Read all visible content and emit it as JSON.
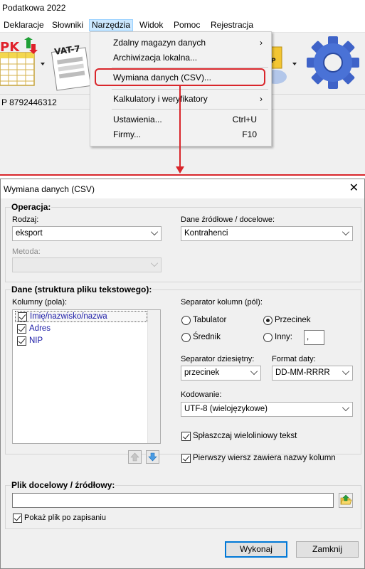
{
  "app": {
    "title": "Podatkowa 2022",
    "menu": [
      "Deklaracje",
      "Słowniki",
      "Narzędzia",
      "Widok",
      "Pomoc",
      "Rejestracja"
    ],
    "status_text": "P 8792446312",
    "toolbar_labels": {
      "vat7": "VAT-7",
      "pk_fragment": "PK"
    }
  },
  "narzedzia_menu": {
    "items": [
      {
        "label": "Zdalny magazyn danych",
        "shortcut": "",
        "submenu": true
      },
      {
        "label": "Archiwizacja lokalna...",
        "shortcut": "",
        "submenu": false
      },
      {
        "label": "Wymiana danych (CSV)...",
        "shortcut": "",
        "submenu": false
      },
      {
        "label": "Kalkulatory i weryfikatory",
        "shortcut": "",
        "submenu": true
      },
      {
        "label": "Ustawienia...",
        "shortcut": "Ctrl+U",
        "submenu": false
      },
      {
        "label": "Firmy...",
        "shortcut": "F10",
        "submenu": false
      }
    ],
    "highlight_color": "#d9262b"
  },
  "dialog": {
    "title": "Wymiana danych (CSV)",
    "operacja": {
      "group_label": "Operacja:",
      "rodzaj_label": "Rodzaj:",
      "rodzaj_value": "eksport",
      "dane_label": "Dane źródłowe / docelowe:",
      "dane_value": "Kontrahenci",
      "metoda_label": "Metoda:",
      "metoda_value": ""
    },
    "dane": {
      "group_label": "Dane (struktura pliku tekstowego):",
      "kolumny_label": "Kolumny (pola):",
      "columns": [
        {
          "label": "Imię/nazwisko/nazwa",
          "checked": true
        },
        {
          "label": "Adres",
          "checked": true
        },
        {
          "label": "NIP",
          "checked": true
        }
      ],
      "separator_label": "Separator kolumn (pól):",
      "separators": {
        "tab": "Tabulator",
        "comma": "Przecinek",
        "semicolon": "Średnik",
        "other": "Inny:",
        "other_value": ",",
        "selected": "Przecinek"
      },
      "decimal_label": "Separator dziesiętny:",
      "decimal_value": "przecinek",
      "date_label": "Format daty:",
      "date_value": "DD-MM-RRRR",
      "encoding_label": "Kodowanie:",
      "encoding_value": "UTF-8 (wielojęzykowe)",
      "flatten_label": "Spłaszczaj wieloliniowy tekst",
      "flatten_checked": true,
      "header_label": "Pierwszy wiersz zawiera nazwy kolumn",
      "header_checked": true
    },
    "plik": {
      "group_label": "Plik docelowy / źródłowy:",
      "value": "",
      "show_label": "Pokaż plik po zapisaniu",
      "show_checked": true
    },
    "buttons": {
      "ok": "Wykonaj",
      "close": "Zamknij"
    }
  }
}
